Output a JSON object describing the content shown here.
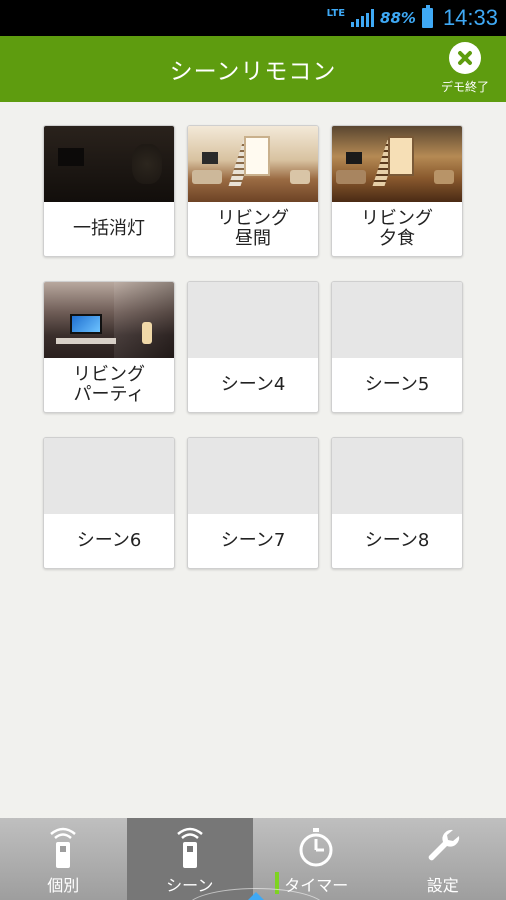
{
  "status_bar": {
    "network": "LTE",
    "battery_percent": "88%",
    "time": "14:33"
  },
  "header": {
    "title": "シーンリモコン",
    "demo_end_label": "デモ終了"
  },
  "scenes": [
    {
      "label": "一括消灯",
      "image": "dark"
    },
    {
      "label": "リビング\n昼間",
      "image": "day"
    },
    {
      "label": "リビング\n夕食",
      "image": "evening"
    },
    {
      "label": "リビング\nパーティ",
      "image": "party"
    },
    {
      "label": "シーン4",
      "image": "empty"
    },
    {
      "label": "シーン5",
      "image": "empty"
    },
    {
      "label": "シーン6",
      "image": "empty"
    },
    {
      "label": "シーン7",
      "image": "empty"
    },
    {
      "label": "シーン8",
      "image": "empty"
    }
  ],
  "bottom_nav": {
    "items": [
      {
        "label": "個別",
        "icon": "remote-icon"
      },
      {
        "label": "シーン",
        "icon": "remote-icon"
      },
      {
        "label": "タイマー",
        "icon": "timer-icon"
      },
      {
        "label": "設定",
        "icon": "wrench-icon"
      }
    ],
    "active_index": 1
  },
  "colors": {
    "header_green": "#5e9c0f",
    "status_blue": "#3fa9f5",
    "background": "#f1f1ee"
  }
}
